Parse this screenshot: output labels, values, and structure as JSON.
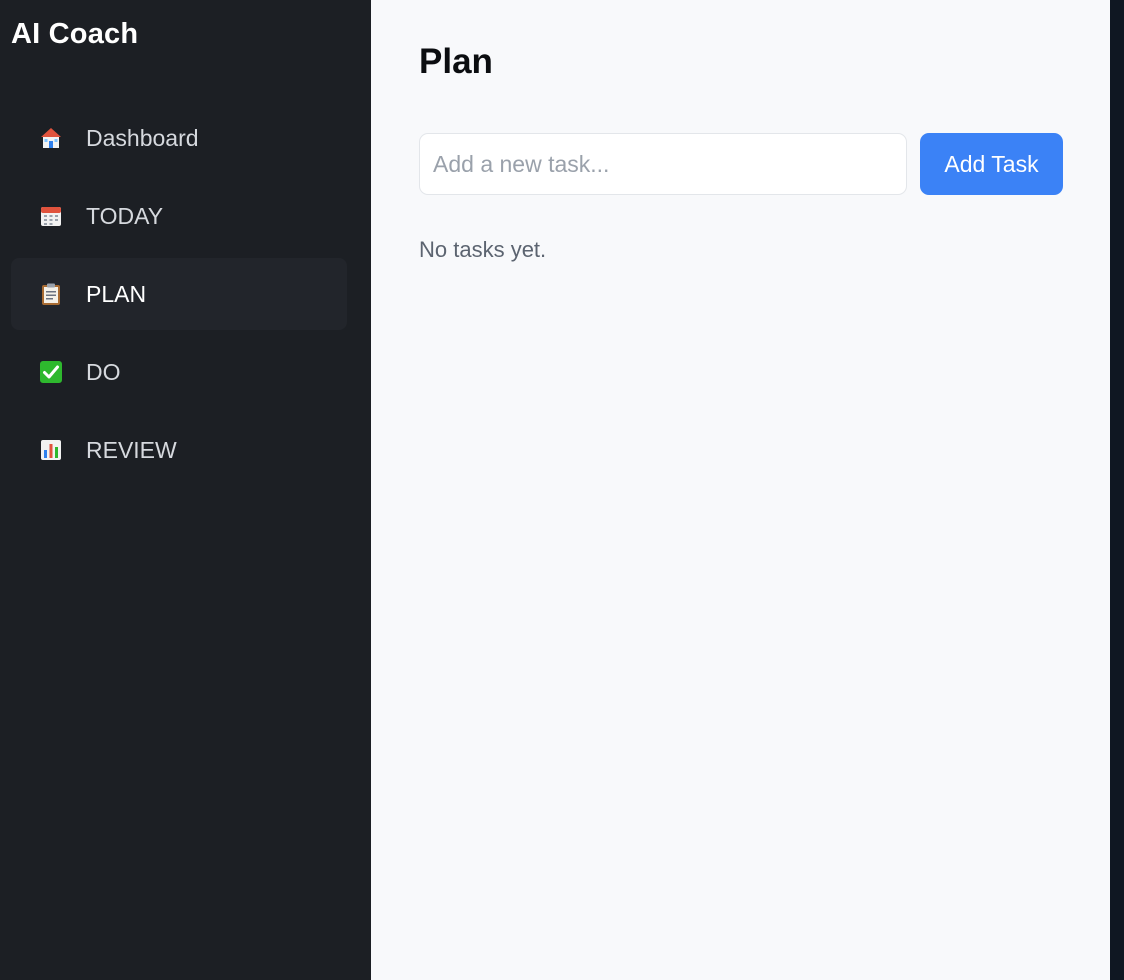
{
  "app": {
    "title": "AI Coach"
  },
  "sidebar": {
    "items": [
      {
        "label": "Dashboard",
        "icon": "house-icon",
        "active": false
      },
      {
        "label": "TODAY",
        "icon": "calendar-icon",
        "active": false
      },
      {
        "label": "PLAN",
        "icon": "clipboard-icon",
        "active": true
      },
      {
        "label": "DO",
        "icon": "check-mark-icon",
        "active": false
      },
      {
        "label": "REVIEW",
        "icon": "bar-chart-icon",
        "active": false
      }
    ]
  },
  "main": {
    "title": "Plan",
    "task_input": {
      "placeholder": "Add a new task...",
      "value": ""
    },
    "add_button_label": "Add Task",
    "empty_message": "No tasks yet."
  },
  "colors": {
    "sidebar_bg": "#1c1f24",
    "main_bg": "#f8f9fb",
    "accent": "#3b82f6",
    "check_green": "#22c55e"
  }
}
